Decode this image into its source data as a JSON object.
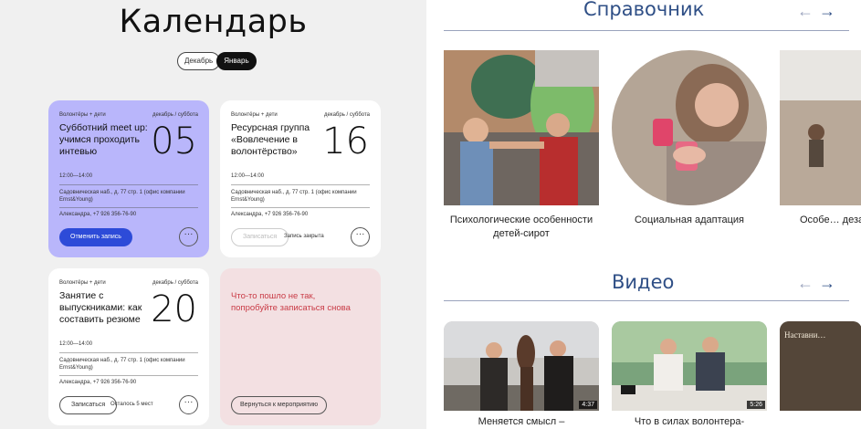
{
  "calendar": {
    "title": "Календарь",
    "months": [
      "Декабрь",
      "Январь"
    ],
    "active_month": "Январь",
    "cards": [
      {
        "tag": "Волонтёры + дети",
        "date": "декабрь / суббота",
        "name": "Субботний meet up: учимся проходить интевью",
        "day": "05",
        "time": "12:00—14:00",
        "address": "Садовническая наб., д. 77 стр. 1 (офис компании Ernst&Young)",
        "contact": "Александра, +7 926 356-76-90",
        "button": "Отменить запись",
        "button_style": "primary"
      },
      {
        "tag": "Волонтёры + дети",
        "date": "декабрь / суббота",
        "name": "Ресурсная группа «Вовлечение в волонтёрство»",
        "day": "16",
        "time": "12:00—14:00",
        "address": "Садовническая наб., д. 77 стр. 1 (офис компании Ernst&Young)",
        "contact": "Александра, +7 926 356-76-90",
        "button": "Записаться",
        "button_style": "disabled",
        "note": "Запись закрыта"
      },
      {
        "tag": "Волонтёры + дети",
        "date": "декабрь / суббота",
        "name": "Занятие с выпускниками: как составить резюме",
        "day": "20",
        "time": "12:00—14:00",
        "address": "Садовническая наб., д. 77 стр. 1 (офис компании Ernst&Young)",
        "contact": "Александра, +7 926 356-76-90",
        "button": "Записаться",
        "button_style": "ghost",
        "note": "Осталось 5 мест"
      }
    ],
    "error_card": {
      "message": "Что-то пошло не так, попробуйте записаться снова",
      "button": "Вернуться к мероприятию"
    },
    "more_glyph": "···"
  },
  "reference": {
    "title": "Справочник",
    "items": [
      "Психологические особенности детей-сирот",
      "Социальная адаптация",
      "Особе… дезад…"
    ]
  },
  "video": {
    "title": "Видео",
    "items": [
      {
        "caption": "Меняется смысл –",
        "duration": "4:37"
      },
      {
        "caption": "Что в силах волонтера-",
        "duration": "5:26"
      },
      {
        "caption": "Наставни…",
        "duration": ""
      }
    ]
  },
  "arrows": {
    "prev": "←",
    "next": "→"
  },
  "colors": {
    "accent": "#2d4bd8",
    "card_highlight": "#b9b6fb",
    "error": "#c93b46",
    "section_title": "#2f4f86"
  }
}
